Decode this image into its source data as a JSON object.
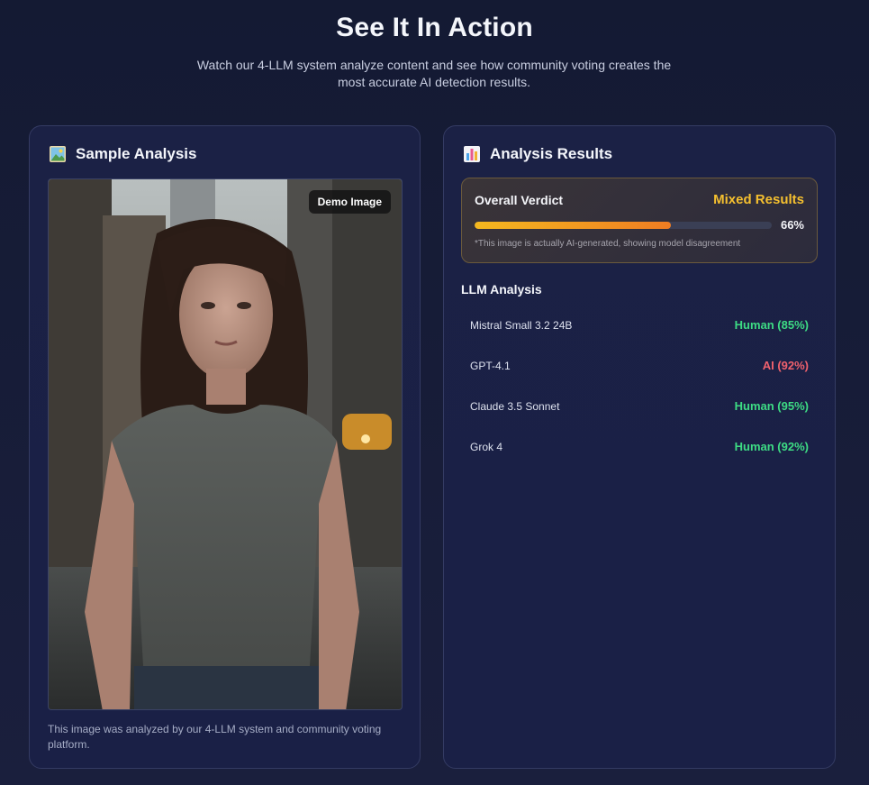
{
  "header": {
    "title": "See It In Action",
    "subtitle": "Watch our 4-LLM system analyze content and see how community voting creates the most accurate AI detection results."
  },
  "sample": {
    "title": "Sample Analysis",
    "icon": "picture-icon",
    "badge": "Demo Image",
    "caption": "This image was analyzed by our 4-LLM system and community voting platform."
  },
  "results": {
    "title": "Analysis Results",
    "icon": "bar-chart-icon",
    "verdict": {
      "label": "Overall Verdict",
      "value": "Mixed Results",
      "percent": 66,
      "percent_label": "66%",
      "note": "*This image is actually AI-generated, showing model disagreement"
    },
    "llm_title": "LLM Analysis",
    "llms": [
      {
        "name": "Mistral Small 3.2 24B",
        "result": "Human (85%)",
        "color": "#3ddc84"
      },
      {
        "name": "GPT-4.1",
        "result": "AI (92%)",
        "color": "#f0616d"
      },
      {
        "name": "Claude 3.5 Sonnet",
        "result": "Human (95%)",
        "color": "#3ddc84"
      },
      {
        "name": "Grok 4",
        "result": "Human (92%)",
        "color": "#3ddc84"
      }
    ]
  }
}
